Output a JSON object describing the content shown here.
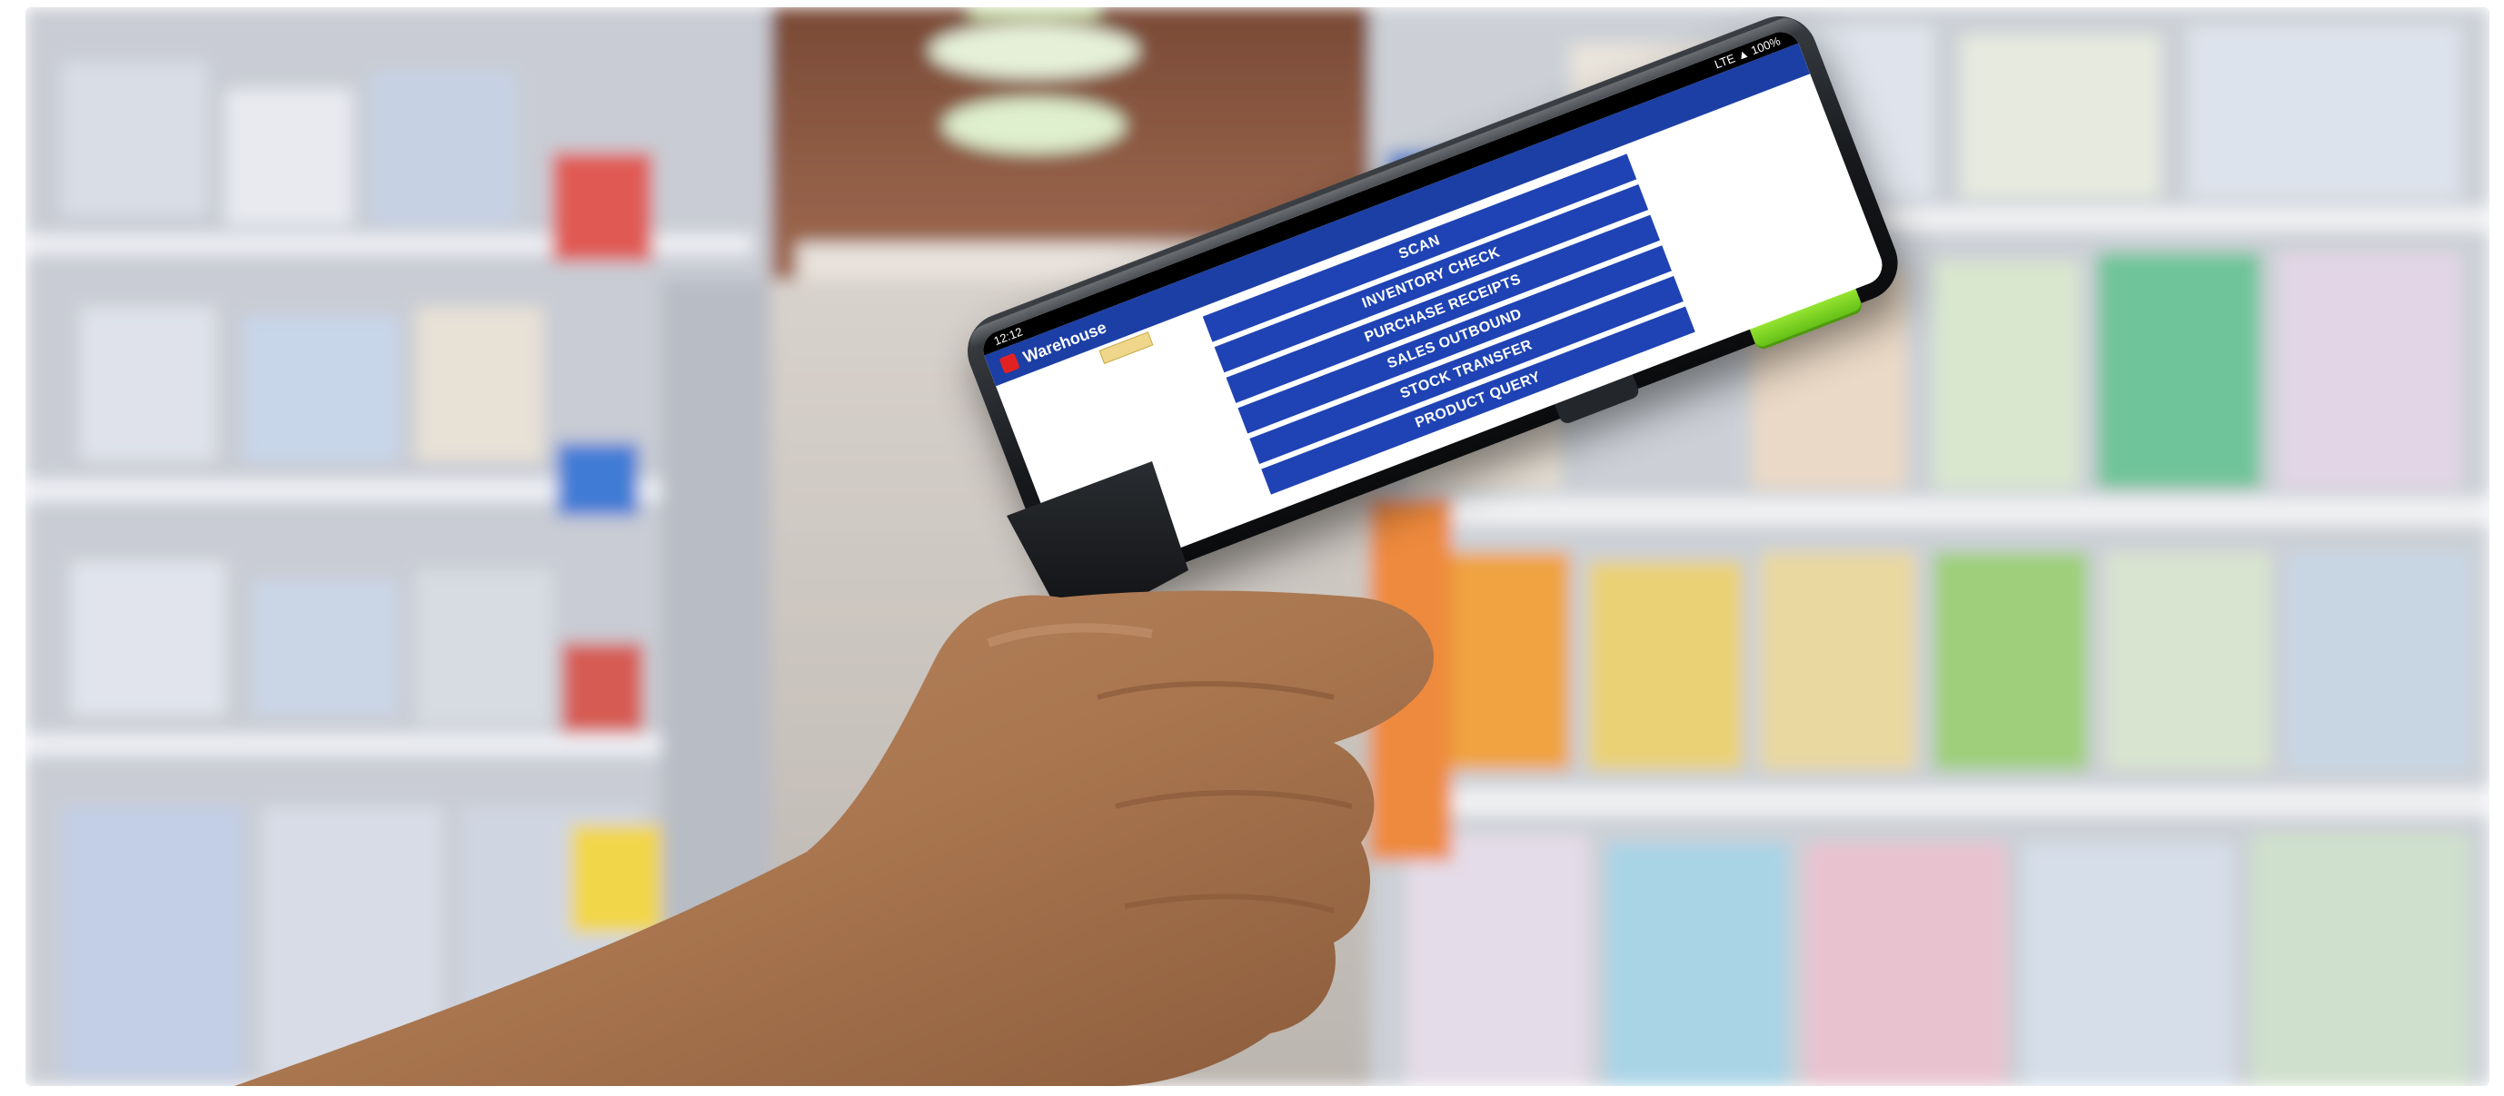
{
  "status_bar": {
    "time": "12:12",
    "indicators": "LTE ▲ 100%"
  },
  "app_bar": {
    "title": "Warehouse",
    "logo_icon": "app-logo-icon"
  },
  "menu": {
    "items": [
      {
        "label": "SCAN"
      },
      {
        "label": "INVENTORY CHECK"
      },
      {
        "label": "PURCHASE RECEIPTS"
      },
      {
        "label": "SALES OUTBOUND"
      },
      {
        "label": "STOCK TRANSFER"
      },
      {
        "label": "PRODUCT QUERY"
      }
    ]
  },
  "colors": {
    "app_bar": "#1c3fa6",
    "menu_button": "#1f43b4",
    "scan_trigger": "#7ed321",
    "device_body": "#16181b"
  }
}
